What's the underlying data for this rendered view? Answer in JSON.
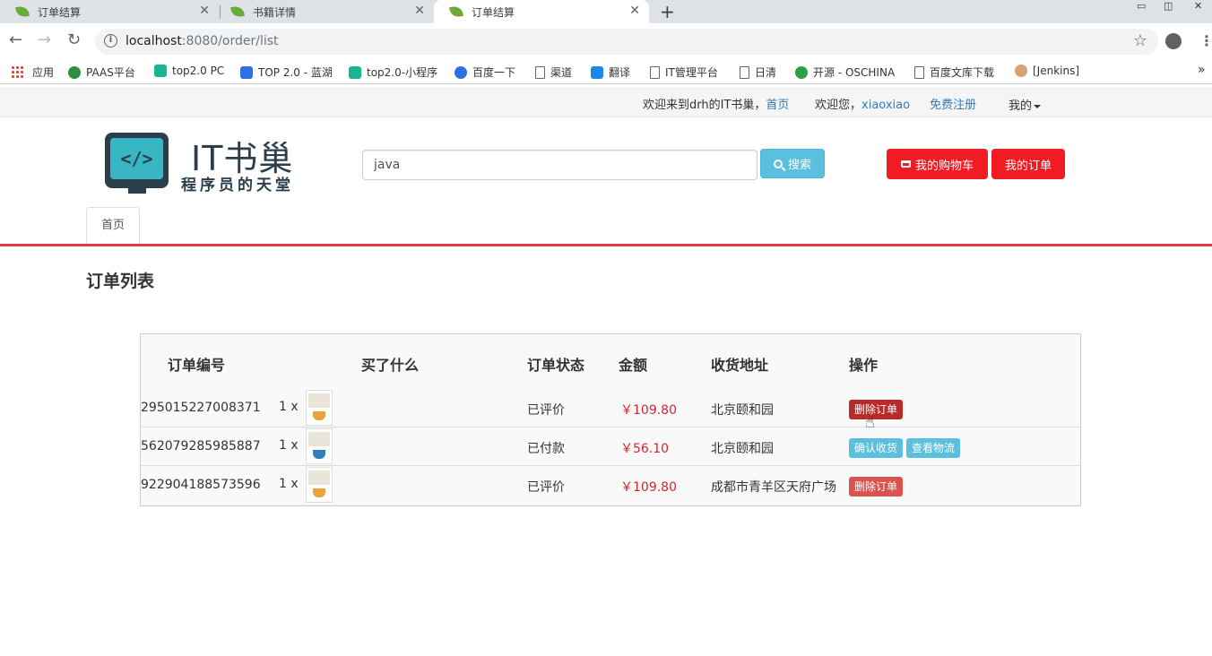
{
  "browser": {
    "tabs": [
      {
        "title": "订单结算"
      },
      {
        "title": "书籍详情"
      },
      {
        "title": "订单结算"
      }
    ],
    "url_host": "localhost",
    "url_path": ":8080/order/list",
    "bookmarks": [
      {
        "label": "应用"
      },
      {
        "label": "PAAS平台"
      },
      {
        "label": "top2.0 PC"
      },
      {
        "label": "TOP 2.0 - 蓝湖"
      },
      {
        "label": "top2.0-小程序"
      },
      {
        "label": "百度一下"
      },
      {
        "label": "渠道"
      },
      {
        "label": "翻译"
      },
      {
        "label": "IT管理平台"
      },
      {
        "label": "日清"
      },
      {
        "label": "开源 - OSCHINA"
      },
      {
        "label": "百度文库下载"
      },
      {
        "label": "[Jenkins]"
      }
    ]
  },
  "topbar": {
    "welcome": "欢迎来到drh的IT书巢，",
    "home_link": "首页",
    "hello": "欢迎您，",
    "username": "xiaoxiao",
    "register": "免费注册",
    "mine": "我的"
  },
  "header": {
    "logo_title": "IT书巢",
    "logo_slogan": "程序员的天堂",
    "search_value": "java",
    "search_button": "搜索",
    "cart_button": "我的购物车",
    "orders_button": "我的订单"
  },
  "nav": {
    "home_tab": "首页"
  },
  "page_title": "订单列表",
  "table": {
    "headers": [
      "订单编号",
      "买了什么",
      "订单状态",
      "金额",
      "收货地址",
      "操作"
    ],
    "rows": [
      {
        "order_no": "295015227008371",
        "qty": "1 x",
        "status": "已评价",
        "amount": "￥109.80",
        "address": "北京颐和园",
        "actions": [
          "删除订单"
        ]
      },
      {
        "order_no": "562079285985887",
        "qty": "1 x",
        "status": "已付款",
        "amount": "￥56.10",
        "address": "北京颐和园",
        "actions": [
          "确认收货",
          "查看物流"
        ]
      },
      {
        "order_no": "922904188573596",
        "qty": "1 x",
        "status": "已评价",
        "amount": "￥109.80",
        "address": "成都市青羊区天府广场",
        "actions": [
          "删除订单"
        ]
      }
    ]
  },
  "colors": {
    "brand_red": "#f11c23",
    "info": "#5bc0de",
    "danger": "#d9534f",
    "price": "#d9232d"
  }
}
